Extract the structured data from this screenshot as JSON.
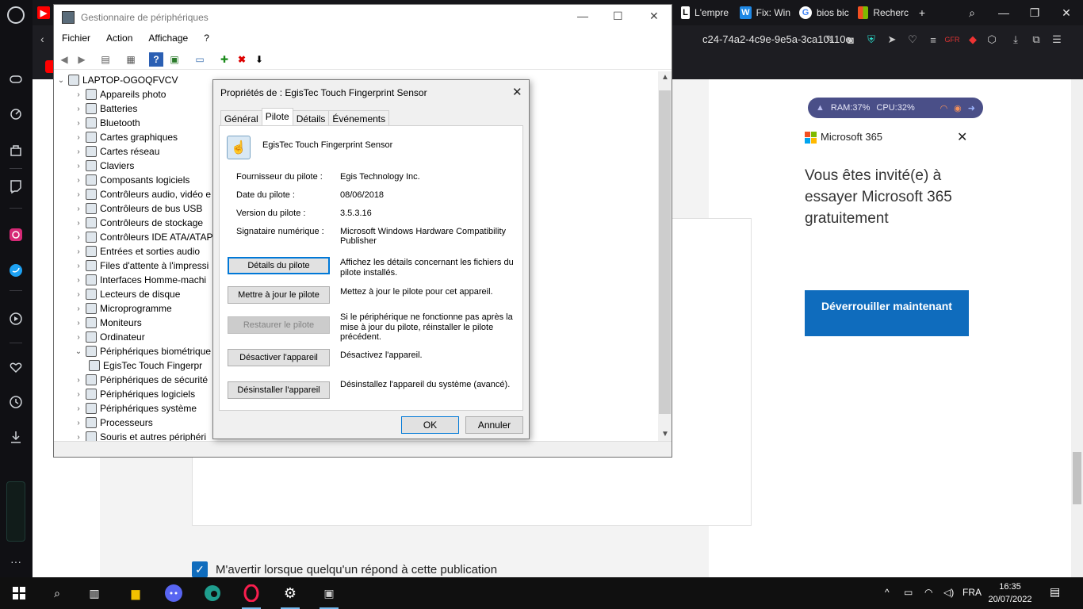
{
  "browser": {
    "tabs": [
      {
        "label": "L'empre",
        "icon": "doc-tab-icon",
        "color": "#ffffff"
      },
      {
        "label": "Fix: Win",
        "icon": "w-tab-icon",
        "color": "#1e88e5"
      },
      {
        "label": "bios bic",
        "icon": "google-icon",
        "color": "#ffffff"
      },
      {
        "label": "Recherc",
        "icon": "microsoft-icon",
        "color": "#f25022"
      }
    ],
    "new_tab": "+",
    "address_fragment": "c24-74a2-4c9e-9e5a-3ca10110e"
  },
  "device_manager": {
    "title": "Gestionnaire de périphériques",
    "menu": [
      "Fichier",
      "Action",
      "Affichage",
      "?"
    ],
    "root": "LAPTOP-OGOQFVCV",
    "items": [
      {
        "label": "Appareils photo",
        "expanded": false
      },
      {
        "label": "Batteries",
        "expanded": false
      },
      {
        "label": "Bluetooth",
        "expanded": false
      },
      {
        "label": "Cartes graphiques",
        "expanded": false
      },
      {
        "label": "Cartes réseau",
        "expanded": false
      },
      {
        "label": "Claviers",
        "expanded": false
      },
      {
        "label": "Composants logiciels",
        "expanded": false
      },
      {
        "label": "Contrôleurs audio, vidéo e",
        "expanded": false
      },
      {
        "label": "Contrôleurs de bus USB",
        "expanded": false
      },
      {
        "label": "Contrôleurs de stockage",
        "expanded": false
      },
      {
        "label": "Contrôleurs IDE ATA/ATAP",
        "expanded": false
      },
      {
        "label": "Entrées et sorties audio",
        "expanded": false
      },
      {
        "label": "Files d'attente à l'impressi",
        "expanded": false
      },
      {
        "label": "Interfaces Homme-machi",
        "expanded": false
      },
      {
        "label": "Lecteurs de disque",
        "expanded": false
      },
      {
        "label": "Microprogramme",
        "expanded": false
      },
      {
        "label": "Moniteurs",
        "expanded": false
      },
      {
        "label": "Ordinateur",
        "expanded": false
      },
      {
        "label": "Périphériques biométrique",
        "expanded": true
      },
      {
        "label": "EgisTec Touch Fingerpr",
        "child": true
      },
      {
        "label": "Périphériques de sécurité",
        "expanded": false
      },
      {
        "label": "Périphériques logiciels",
        "expanded": false
      },
      {
        "label": "Périphériques système",
        "expanded": false
      },
      {
        "label": "Processeurs",
        "expanded": false
      },
      {
        "label": "Souris et autres périphéri",
        "expanded": false
      }
    ]
  },
  "properties": {
    "title": "Propriétés de : EgisTec Touch Fingerprint Sensor",
    "tabs": [
      "Général",
      "Pilote",
      "Détails",
      "Événements"
    ],
    "active_tab": "Pilote",
    "device_name": "EgisTec Touch Fingerprint Sensor",
    "fields": [
      {
        "label": "Fournisseur du pilote :",
        "value": "Egis Technology Inc."
      },
      {
        "label": "Date du pilote :",
        "value": "08/06/2018"
      },
      {
        "label": "Version du pilote :",
        "value": "3.5.3.16"
      },
      {
        "label": "Signataire numérique :",
        "value": "Microsoft Windows Hardware Compatibility Publisher"
      }
    ],
    "actions": [
      {
        "button": "Détails du pilote",
        "desc": "Affichez les détails concernant les fichiers du pilote installés.",
        "state": "focused"
      },
      {
        "button": "Mettre à jour le pilote",
        "desc": "Mettez à jour le pilote pour cet appareil.",
        "state": "normal"
      },
      {
        "button": "Restaurer le pilote",
        "desc": "Si le périphérique ne fonctionne pas après la mise à jour du pilote, réinstaller le pilote précédent.",
        "state": "disabled"
      },
      {
        "button": "Désactiver l'appareil",
        "desc": "Désactivez l'appareil.",
        "state": "normal"
      },
      {
        "button": "Désinstaller l'appareil",
        "desc": "Désinstallez l'appareil du système (avancé).",
        "state": "normal"
      }
    ],
    "ok": "OK",
    "cancel": "Annuler"
  },
  "page": {
    "ram": "RAM:37%",
    "cpu": "CPU:32%",
    "ms_brand": "Microsoft 365",
    "invite": "Vous êtes invité(e) à essayer Microsoft 365 gratuitement",
    "unlock": "Déverrouiller maintenant",
    "notify": "M'avertir lorsque quelqu'un répond à cette publication"
  },
  "taskbar": {
    "lang": "FRA",
    "time": "16:35",
    "date": "20/07/2022"
  },
  "colors": {
    "accent": "#0f6cbd",
    "focus": "#0078d7"
  }
}
